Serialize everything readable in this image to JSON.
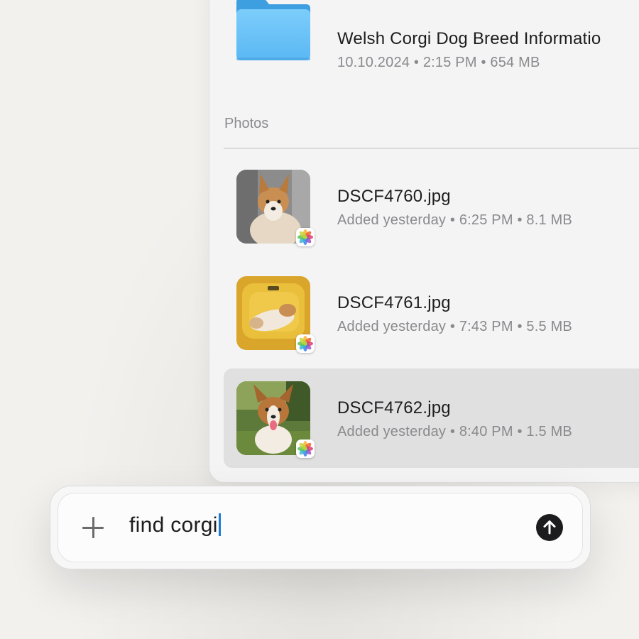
{
  "results": {
    "top_item": {
      "title": "Welsh Corgi Dog Breed Informatio",
      "meta": "10.10.2024 • 2:15 PM • 654 MB",
      "icon": "folder-icon"
    },
    "section_label": "Photos",
    "photos": [
      {
        "title": "DSCF4760.jpg",
        "meta": "Added yesterday • 6:25 PM • 8.1 MB",
        "badge": "photos-app-icon"
      },
      {
        "title": "DSCF4761.jpg",
        "meta": "Added yesterday • 7:43 PM • 5.5 MB",
        "badge": "photos-app-icon"
      },
      {
        "title": "DSCF4762.jpg",
        "meta": "Added yesterday • 8:40 PM • 1.5 MB",
        "badge": "photos-app-icon",
        "selected": true
      }
    ]
  },
  "input": {
    "value": "find corgi",
    "add_icon": "plus-icon",
    "send_icon": "arrow-up-icon"
  },
  "colors": {
    "caret": "#1a7bd8",
    "folder": "#5ab8f3",
    "selected_row": "#e0e0e0"
  }
}
